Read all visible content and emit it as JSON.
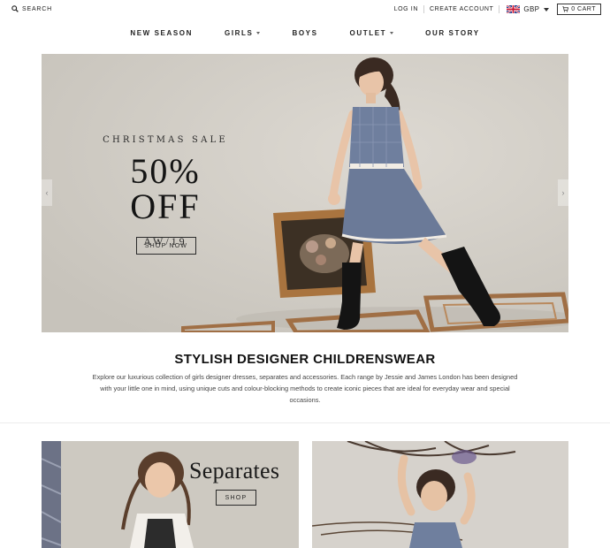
{
  "topbar": {
    "search_label": "SEARCH",
    "login_label": "LOG IN",
    "create_account_label": "CREATE ACCOUNT",
    "currency": "GBP",
    "cart_label": "0 CART"
  },
  "nav": {
    "items": [
      {
        "label": "NEW SEASON",
        "dropdown": false
      },
      {
        "label": "GIRLS",
        "dropdown": true
      },
      {
        "label": "BOYS",
        "dropdown": false
      },
      {
        "label": "OUTLET",
        "dropdown": true
      },
      {
        "label": "OUR STORY",
        "dropdown": false
      }
    ]
  },
  "hero": {
    "subtitle": "CHRISTMAS SALE",
    "headline": "50% OFF",
    "season": "AW/19",
    "button_label": "SHOP NOW",
    "prev_arrow": "‹",
    "next_arrow": "›"
  },
  "intro": {
    "title": "STYLISH DESIGNER CHILDRENSWEAR",
    "body": "Explore our luxurious collection of girls designer dresses, separates and accessories. Each range by Jessie and James London has been designed with your little one in mind, using unique cuts and colour-blocking methods to create iconic pieces that are ideal for everyday wear and special occasions."
  },
  "tiles": [
    {
      "title": "Separates",
      "button_label": "SHOP"
    },
    {
      "title": "",
      "button_label": ""
    }
  ],
  "colors": {
    "text": "#222222",
    "hero_bg": "#d2cfc8",
    "dress": "#6f7f9e"
  },
  "icons": {
    "search": "search-icon",
    "flag": "uk-flag-icon",
    "cart": "cart-icon"
  }
}
